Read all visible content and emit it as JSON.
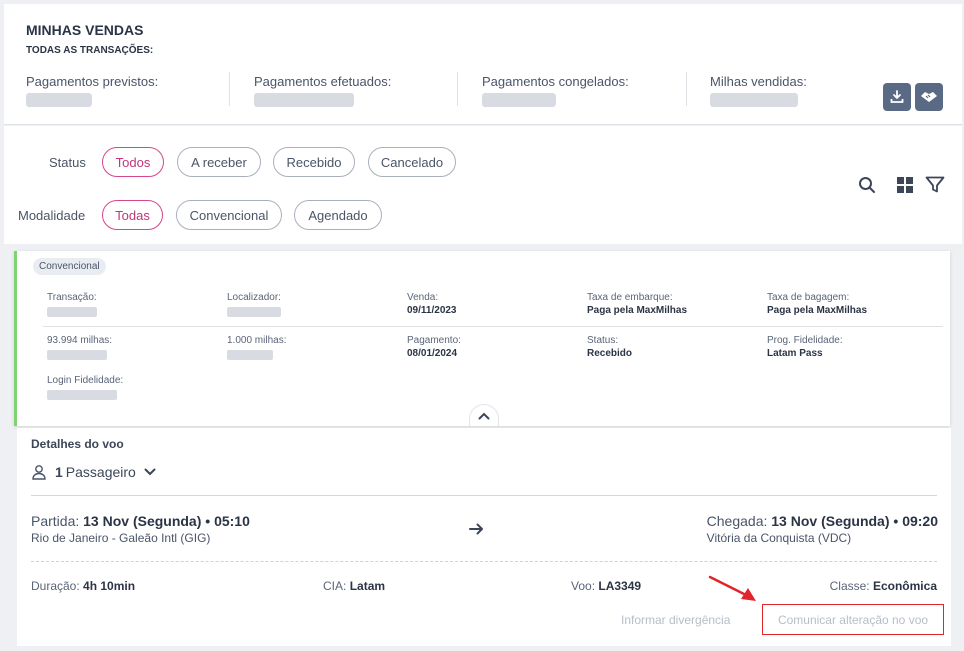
{
  "header": {
    "title": "MINHAS VENDAS",
    "subtitle": "TODAS AS TRANSAÇÕES:"
  },
  "summary": [
    {
      "label": "Pagamentos previstos:"
    },
    {
      "label": "Pagamentos efetuados:"
    },
    {
      "label": "Pagamentos congelados:"
    },
    {
      "label": "Milhas vendidas:"
    }
  ],
  "actions": {
    "download_icon": "download-icon",
    "handshake_icon": "handshake-icon"
  },
  "filters": {
    "status_label": "Status",
    "status_options": [
      "Todos",
      "A receber",
      "Recebido",
      "Cancelado"
    ],
    "status_selected": "Todos",
    "modalidade_label": "Modalidade",
    "modalidade_options": [
      "Todas",
      "Convencional",
      "Agendado"
    ],
    "modalidade_selected": "Todas"
  },
  "card": {
    "badge": "Convencional",
    "transacao_label": "Transação:",
    "localizador_label": "Localizador:",
    "venda_label": "Venda:",
    "venda_value": "09/11/2023",
    "taxa_embarque_label": "Taxa de embarque:",
    "taxa_embarque_value": "Paga pela MaxMilhas",
    "taxa_bagagem_label": "Taxa de bagagem:",
    "taxa_bagagem_value": "Paga pela MaxMilhas",
    "milhas1_label": "93.994 milhas:",
    "milhas2_label": "1.000 milhas:",
    "pagamento_label": "Pagamento:",
    "pagamento_value": "08/01/2024",
    "status_label": "Status:",
    "status_value": "Recebido",
    "prog_label": "Prog. Fidelidade:",
    "prog_value": "Latam Pass",
    "login_label": "Login Fidelidade:"
  },
  "flight": {
    "title": "Detalhes do voo",
    "passenger_count": "1",
    "passenger_label": "Passageiro",
    "departure_label": "Partida:",
    "departure_value": "13 Nov (Segunda) • 05:10",
    "departure_airport": "Rio de Janeiro - Galeão Intl (GIG)",
    "arrival_label": "Chegada:",
    "arrival_value": "13 Nov (Segunda) • 09:20",
    "arrival_airport": "Vitória da Conquista (VDC)",
    "duration_label": "Duração:",
    "duration_value": "4h 10min",
    "cia_label": "CIA:",
    "cia_value": "Latam",
    "voo_label": "Voo:",
    "voo_value": "LA3349",
    "classe_label": "Classe:",
    "classe_value": "Econômica",
    "link_divergencia": "Informar divergência",
    "link_alteracao": "Comunicar alteração no voo"
  },
  "colors": {
    "accent_pink": "#d6468a",
    "success_green": "#7dd36f",
    "highlight_red": "#e0262b",
    "icon_button_bg": "#5a6a85"
  }
}
